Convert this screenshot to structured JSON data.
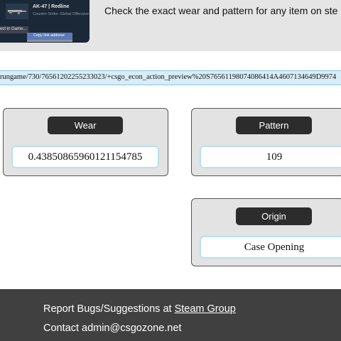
{
  "banner": {
    "item_name": "AK-47 | Redline",
    "item_game": "Counter-Strike: Global Offensive",
    "context_left": "ect in Game...",
    "context_copy": "Copy link address",
    "headline": "Check the exact wear and pattern for any item on ste"
  },
  "url": {
    "value": "rungame/730/76561202255233023/+csgo_econ_action_preview%20S76561198074086414A4607134649D9974"
  },
  "wear": {
    "label": "Wear",
    "value": "0.4385086596012115478​5"
  },
  "pattern": {
    "label": "Pattern",
    "value": "109"
  },
  "origin": {
    "label": "Origin",
    "value": "Case Opening"
  },
  "footer": {
    "bugs_prefix": "Report Bugs/Suggestions at ",
    "bugs_link": "Steam Group",
    "contact": "Contact admin@csgozone.net"
  },
  "colors": {
    "footer_bg": "#404040",
    "panel_bg": "#e3e3e3",
    "label_bg": "#2c2c2c",
    "value_border": "#b7e1ef",
    "url_bg": "#d8edf6"
  }
}
